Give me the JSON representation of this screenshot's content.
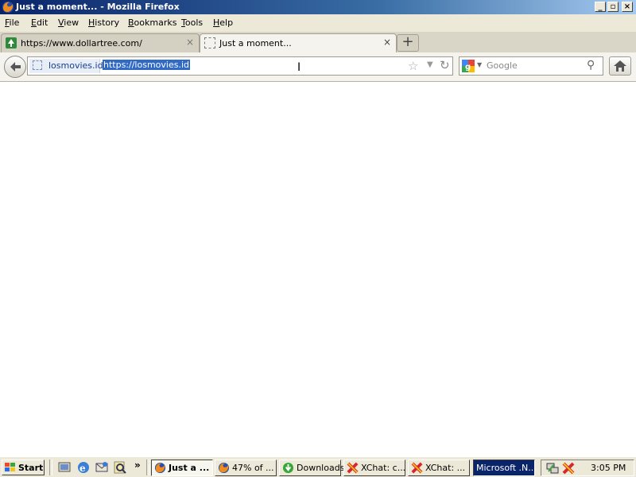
{
  "window": {
    "title": "Just a moment... - Mozilla Firefox"
  },
  "menu": [
    {
      "key": "F",
      "rest": "ile"
    },
    {
      "key": "E",
      "rest": "dit"
    },
    {
      "key": "V",
      "rest": "iew"
    },
    {
      "key": "H",
      "rest": "istory"
    },
    {
      "key": "B",
      "rest": "ookmarks"
    },
    {
      "key": "T",
      "rest": "ools"
    },
    {
      "key": "H",
      "rest": "elp"
    }
  ],
  "tabs": [
    {
      "label": "https://www.dollartree.com/",
      "close": "×"
    },
    {
      "label": "Just a moment...",
      "close": "×"
    }
  ],
  "newtab_label": "+",
  "urlbar": {
    "host": "losmovies.id",
    "url": "https://losmovies.id"
  },
  "search": {
    "placeholder": "Google"
  },
  "taskbar": {
    "start": "Start",
    "overflow": "»",
    "buttons": [
      {
        "label": "Just a ..."
      },
      {
        "label": "47% of ..."
      },
      {
        "label": "Downloads"
      },
      {
        "label": "XChat: c..."
      },
      {
        "label": "XChat: ..."
      },
      {
        "label": "Microsoft .N..."
      }
    ],
    "clock": "3:05 PM"
  },
  "colors": {
    "title_active": "#0a246a",
    "selection": "#316ac5",
    "taskbar_active": "#0a246a"
  }
}
